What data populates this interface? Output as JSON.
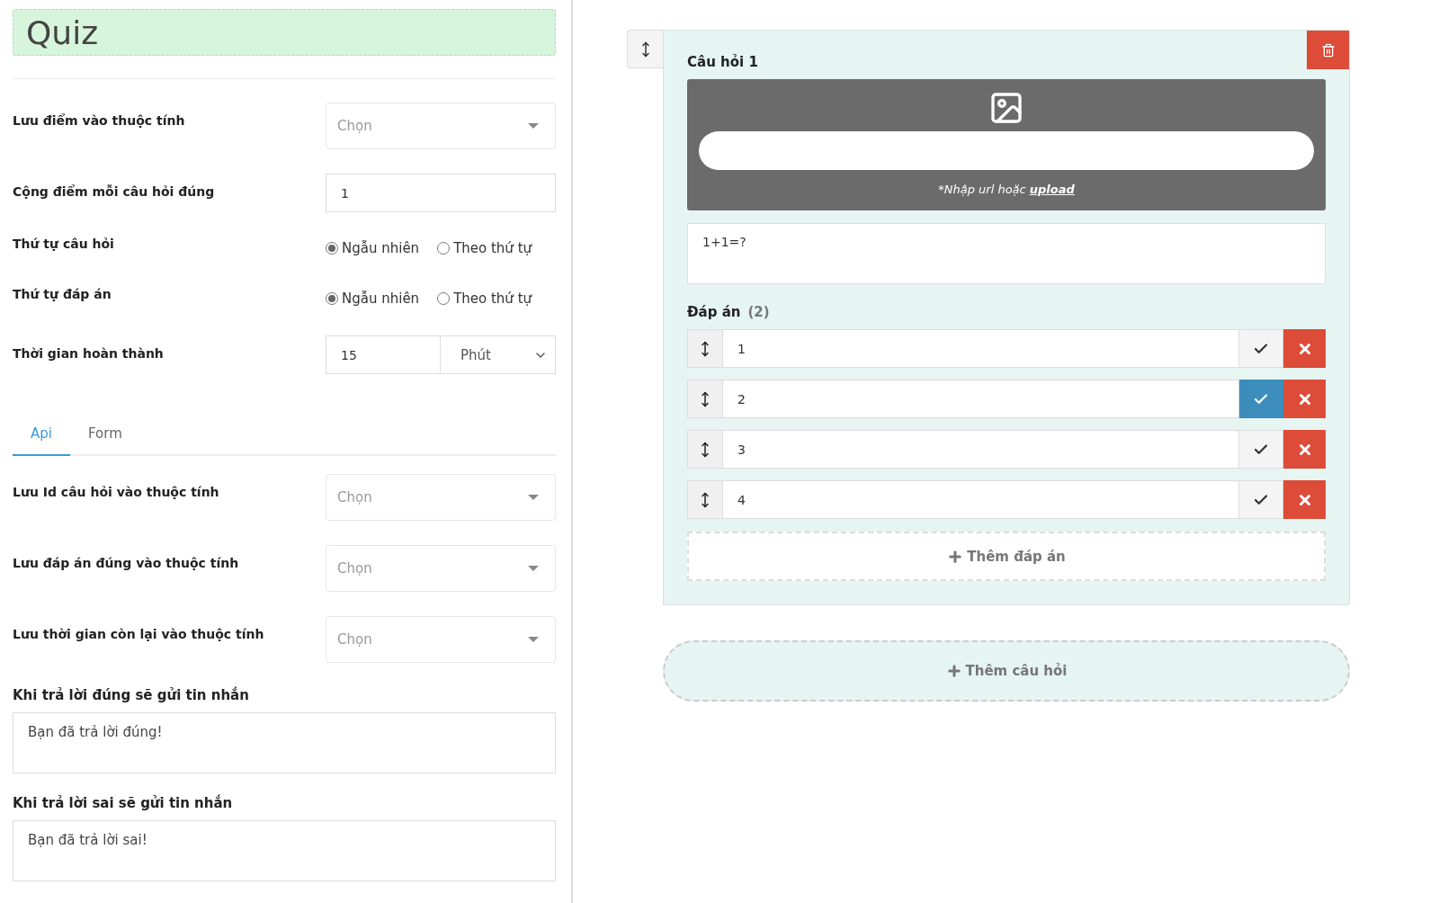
{
  "title": "Quiz",
  "settings": [
    {
      "kind": "select",
      "label": "Lưu điểm vào thuộc tính",
      "placeholder": "Chọn"
    },
    {
      "kind": "input",
      "label": "Cộng điểm mỗi câu hỏi đúng",
      "value": "1"
    },
    {
      "kind": "radio",
      "label": "Thứ tự câu hỏi",
      "options": [
        {
          "label": "Ngẫu nhiên",
          "selected": true
        },
        {
          "label": "Theo thứ tự",
          "selected": false
        }
      ]
    },
    {
      "kind": "radio",
      "label": "Thứ tự đáp án",
      "options": [
        {
          "label": "Ngẫu nhiên",
          "selected": true
        },
        {
          "label": "Theo thứ tự",
          "selected": false
        }
      ]
    },
    {
      "kind": "duration",
      "label": "Thời gian hoàn thành",
      "value": "15",
      "unit": "Phút"
    }
  ],
  "tabs": [
    {
      "label": "Api",
      "selected": true
    },
    {
      "label": "Form",
      "selected": false
    }
  ],
  "api_settings": [
    {
      "kind": "select",
      "label": "Lưu Id câu hỏi vào thuộc tính",
      "placeholder": "Chọn"
    },
    {
      "kind": "select",
      "label": "Lưu đáp án đúng vào thuộc tính",
      "placeholder": "Chọn"
    },
    {
      "kind": "select",
      "label": "Lưu thời gian còn lại vào thuộc tính",
      "placeholder": "Chọn"
    },
    {
      "kind": "textarea",
      "label": "Khi trả lời đúng sẽ gửi tin nhắn",
      "value": "Bạn đã trả lời đúng!"
    },
    {
      "kind": "textarea",
      "label": "Khi trả lời sai sẽ gửi tin nhắn",
      "value": "Bạn đã trả lời sai!"
    }
  ],
  "question": {
    "title": "Câu hỏi 1",
    "image_hint": "*Nhập url hoặc",
    "upload_link": "upload",
    "text": "1+1=?",
    "answers_label": "Đáp án",
    "answers_count": "(2)",
    "answers": [
      {
        "value": "1",
        "selected": false
      },
      {
        "value": "2",
        "selected": true
      },
      {
        "value": "3",
        "selected": false
      },
      {
        "value": "4",
        "selected": false
      }
    ],
    "add_answer": "Thêm đáp án"
  },
  "add_question": "Thêm câu hỏi"
}
